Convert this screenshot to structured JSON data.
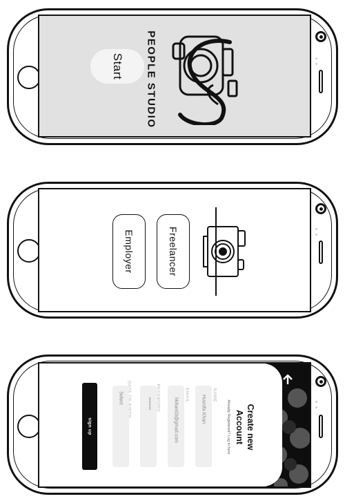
{
  "screens": {
    "welcome": {
      "brand_name": "PEOPLE STUDIO",
      "start_label": "Start"
    },
    "role_select": {
      "freelancer_label": "Freelancer",
      "employer_label": "Employer"
    },
    "signup": {
      "title_line1": "Create new",
      "title_line2": "Account",
      "subtitle": "Already Registered? Log in here",
      "fields": [
        {
          "label": "NAME",
          "value": "Husnifa Khan"
        },
        {
          "label": "EMAIL",
          "value": "hkhan03@gmail.com"
        },
        {
          "label": "PASSWORD",
          "value": "*******"
        },
        {
          "label": "DATE OF BIRTH",
          "value": "Select"
        }
      ],
      "signup_label": "sign up"
    }
  },
  "colors": {
    "phone_outline": "#111111",
    "welcome_bg": "#e1e1e1",
    "button_dark": "#0d0d0d",
    "field_bg": "#efefef"
  },
  "icons": [
    "home-button",
    "front-camera-icon",
    "speaker-icon",
    "camera-logo-icon",
    "back-arrow-icon"
  ]
}
